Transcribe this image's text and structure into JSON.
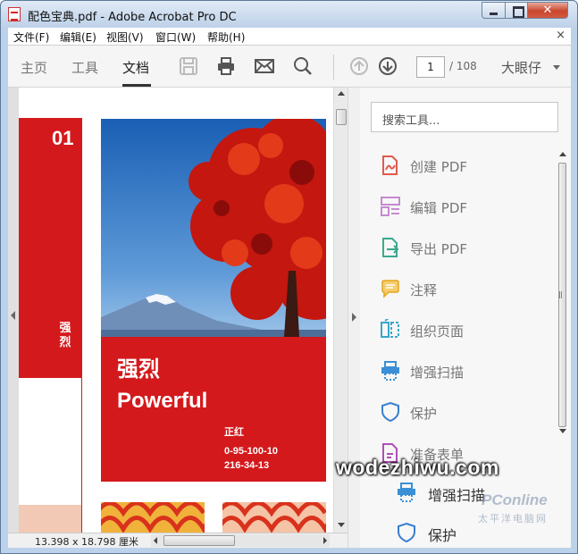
{
  "window": {
    "title": "配色宝典.pdf - Adobe Acrobat Pro DC",
    "close_glyph": "✕"
  },
  "menu": {
    "items": [
      "文件(F)",
      "编辑(E)",
      "视图(V)",
      "窗口(W)",
      "帮助(H)"
    ],
    "close_glyph": "×"
  },
  "toolbar": {
    "tabs": [
      "主页",
      "工具",
      "文档"
    ],
    "active_tab": "文档",
    "page_current": "1",
    "page_total": "/ 108",
    "user": "大眼仔",
    "icons": [
      "save-icon",
      "print-icon",
      "email-icon",
      "search-icon",
      "page-up-icon",
      "page-down-icon"
    ]
  },
  "document": {
    "section_number": "01",
    "vertical_text": "强烈",
    "heading_cn": "强烈",
    "heading_en": "Powerful",
    "color_name": "正红",
    "cmyk": "0-95-100-10",
    "rgb": "216-34-13",
    "accent_color": "#d4191c"
  },
  "statusbar": {
    "page_size": "13.398 x 18.798 厘米"
  },
  "tools_pane": {
    "search_placeholder": "搜索工具...",
    "tools": [
      {
        "label": "创建 PDF",
        "icon": "create-pdf-icon",
        "color": "#e05a4e"
      },
      {
        "label": "编辑 PDF",
        "icon": "edit-pdf-icon",
        "color": "#c58bd0"
      },
      {
        "label": "导出 PDF",
        "icon": "export-pdf-icon",
        "color": "#3ba88c"
      },
      {
        "label": "注释",
        "icon": "comment-icon",
        "color": "#f1b83c"
      },
      {
        "label": "组织页面",
        "icon": "organize-pages-icon",
        "color": "#3aa6c9"
      },
      {
        "label": "增强扫描",
        "icon": "enhance-scan-icon",
        "color": "#3a8fd6"
      },
      {
        "label": "保护",
        "icon": "protect-icon",
        "color": "#3a7fd0"
      },
      {
        "label": "准备表单",
        "icon": "prepare-form-icon",
        "color": "#b04fb8"
      }
    ]
  },
  "overlay": {
    "watermark": "wodezhiwu.com",
    "site_logo": "PConline",
    "site_name": "太平洋电脑网",
    "zoom_tools": [
      {
        "label": "增强扫描",
        "icon": "enhance-scan-icon"
      },
      {
        "label": "保护",
        "icon": "protect-icon"
      }
    ]
  }
}
